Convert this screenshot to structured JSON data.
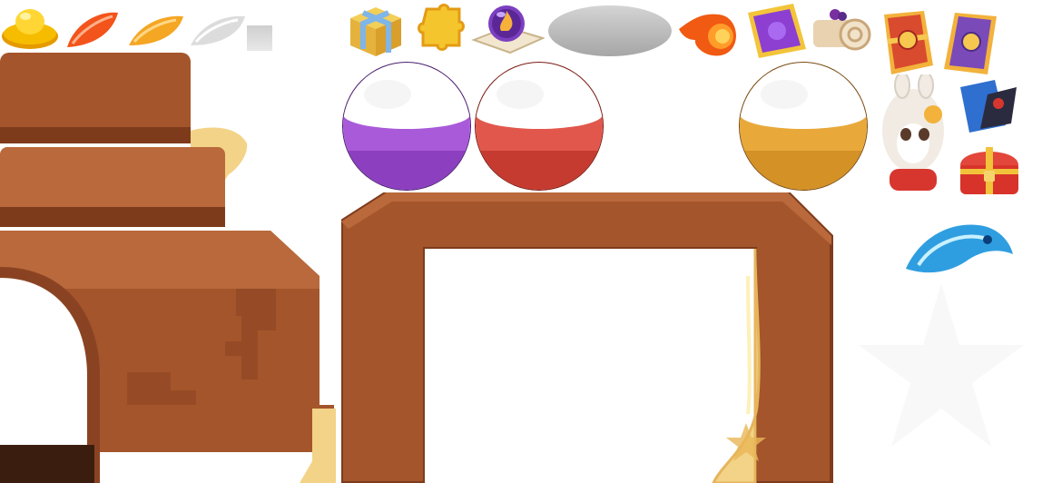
{
  "atlas": {
    "icons": [
      {
        "id": "gold-ingot",
        "name": "gold-ingot-icon",
        "color": "#f5b800"
      },
      {
        "id": "red-feather",
        "name": "red-feather-icon",
        "color": "#f2541b"
      },
      {
        "id": "orange-feather",
        "name": "orange-feather-icon",
        "color": "#f5a623"
      },
      {
        "id": "silver-feather",
        "name": "silver-feather-icon",
        "color": "#d9d9d9"
      },
      {
        "id": "gift-box",
        "name": "gift-box-icon",
        "color": "#f0c23a"
      },
      {
        "id": "puzzle-piece",
        "name": "puzzle-piece-icon",
        "color": "#f5c52d"
      },
      {
        "id": "magic-orb",
        "name": "magic-orb-icon",
        "color": "#7c3fbf"
      },
      {
        "id": "silver-disc",
        "name": "silver-disc-icon",
        "color": "#b9b9b9"
      },
      {
        "id": "fireball",
        "name": "fireball-icon",
        "color": "#f05a12"
      },
      {
        "id": "purple-scroll-card",
        "name": "purple-card-icon",
        "color": "#8c3fd1"
      },
      {
        "id": "rolled-scroll",
        "name": "rolled-scroll-icon",
        "color": "#e8d2b0"
      },
      {
        "id": "red-token-card",
        "name": "red-token-card-icon",
        "color": "#d94b2e"
      },
      {
        "id": "purple-token-card",
        "name": "purple-token-card-icon",
        "color": "#7a4ab8"
      },
      {
        "id": "blue-pouch",
        "name": "blue-pouch-icon",
        "color": "#2e6fd0"
      },
      {
        "id": "treasure-chest",
        "name": "treasure-chest-icon",
        "color": "#d8332a"
      },
      {
        "id": "alpaca-avatar",
        "name": "alpaca-avatar-icon",
        "color": "#f1ebe3"
      },
      {
        "id": "water-dragon",
        "name": "water-dragon-icon",
        "color": "#2f9ee0"
      }
    ],
    "orbs": [
      {
        "id": "purple-orb",
        "color": "#a95ad9",
        "dark": "#6d2fa3"
      },
      {
        "id": "red-orb",
        "color": "#e2574c",
        "dark": "#a3271f"
      },
      {
        "id": "gold-orb",
        "color": "#e8a93a",
        "dark": "#b47419"
      }
    ],
    "panel": {
      "wood": "#a4552b",
      "wood_dark": "#7e3b1c",
      "wood_light": "#b9693b",
      "gold_trim": "#f3d387"
    }
  }
}
